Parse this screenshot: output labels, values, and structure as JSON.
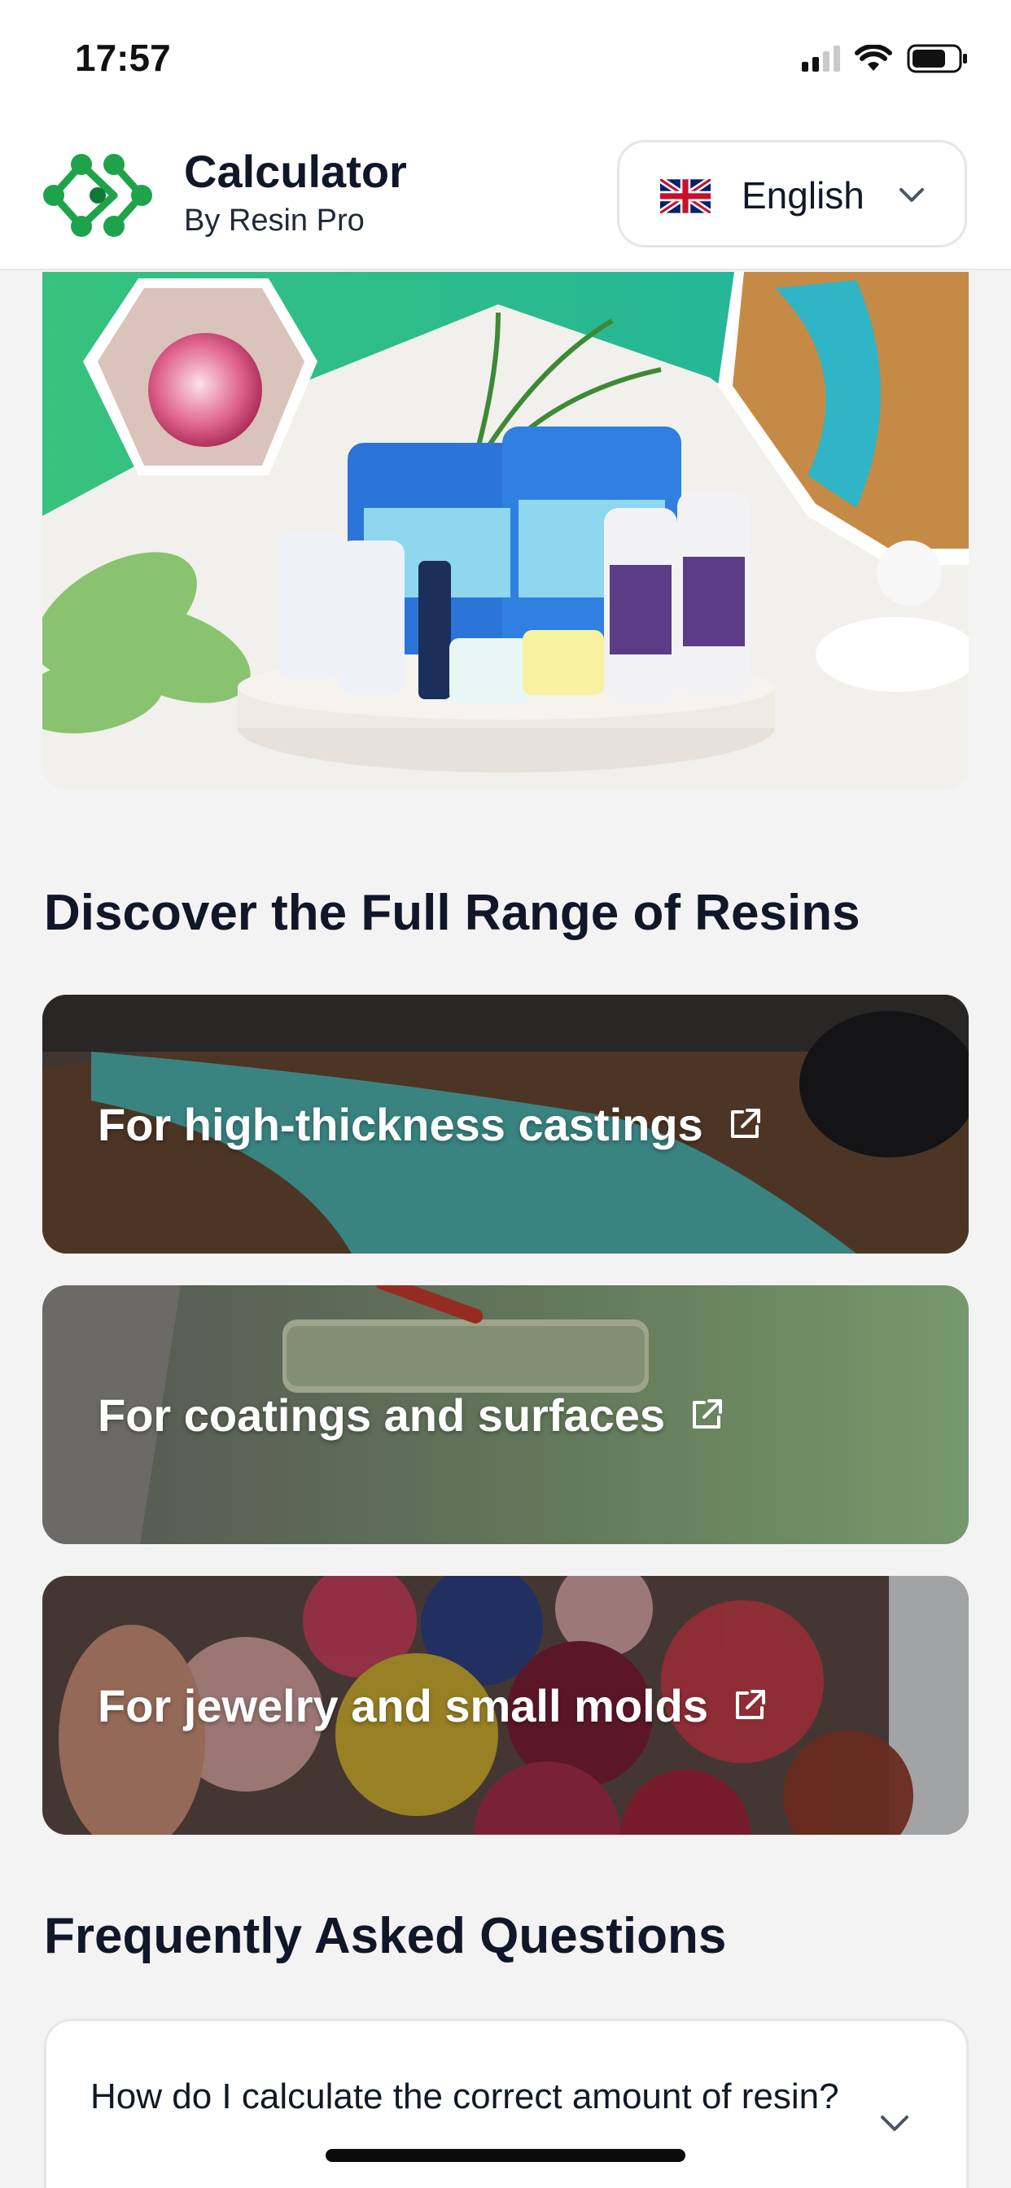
{
  "status_bar": {
    "time": "17:57"
  },
  "header": {
    "title": "Calculator",
    "subtitle": "By Resin Pro",
    "language": {
      "selected": "English",
      "flag_icon": "uk-flag-icon"
    }
  },
  "colors": {
    "brand_green": "#1fa34a",
    "text_dark": "#0f1729",
    "background": "#f3f3f4"
  },
  "range_section": {
    "title": "Discover the Full Range of Resins",
    "cards": [
      {
        "label": "For high-thickness castings",
        "icon": "external-link-icon"
      },
      {
        "label": "For coatings and surfaces",
        "icon": "external-link-icon"
      },
      {
        "label": "For jewelry and small molds",
        "icon": "external-link-icon"
      }
    ]
  },
  "faq_section": {
    "title": "Frequently Asked Questions",
    "items": [
      {
        "question": "How do I calculate the correct amount of resin?"
      }
    ]
  }
}
